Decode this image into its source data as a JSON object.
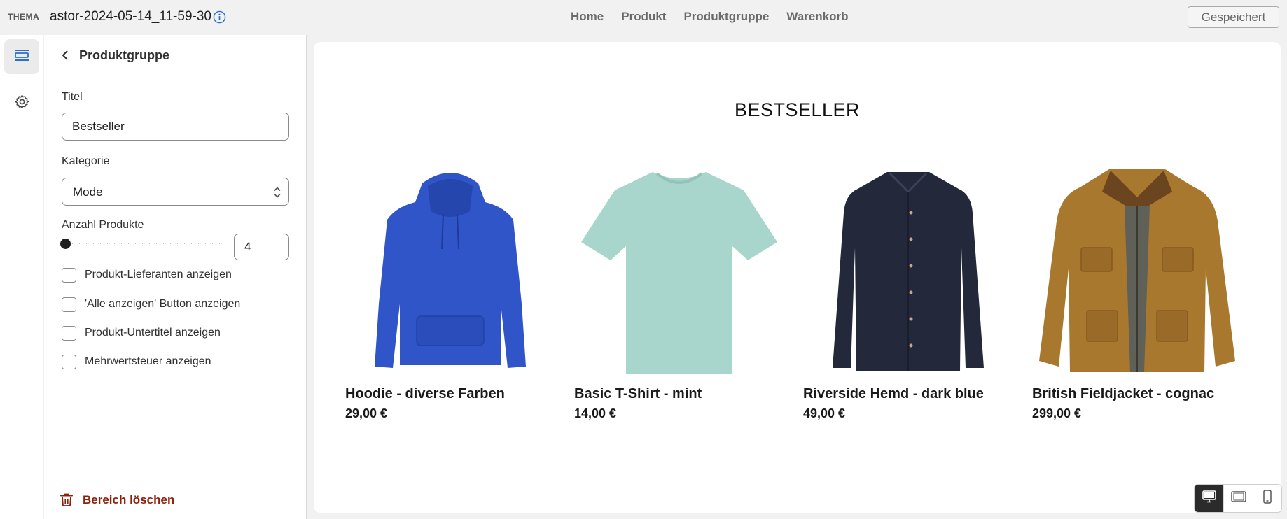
{
  "topbar": {
    "theme_label": "THEMA",
    "filename": "astor-2024-05-14_11-59-30",
    "nav": [
      "Home",
      "Produkt",
      "Produktgruppe",
      "Warenkorb"
    ],
    "save_label": "Gespeichert"
  },
  "rail": {
    "items": [
      {
        "icon": "sections-icon",
        "active": true
      },
      {
        "icon": "gear-icon",
        "active": false
      }
    ]
  },
  "panel": {
    "title": "Produktgruppe",
    "title_field": {
      "label": "Titel",
      "value": "Bestseller"
    },
    "category_field": {
      "label": "Kategorie",
      "value": "Mode"
    },
    "count_field": {
      "label": "Anzahl Produkte",
      "value": "4",
      "slider_fraction": 0
    },
    "checkboxes": [
      {
        "label": "Produkt-Lieferanten anzeigen",
        "checked": false
      },
      {
        "label": "'Alle anzeigen' Button anzeigen",
        "checked": false
      },
      {
        "label": "Produkt-Untertitel anzeigen",
        "checked": false
      },
      {
        "label": "Mehrwertsteuer anzeigen",
        "checked": false
      }
    ],
    "delete_label": "Bereich löschen"
  },
  "preview": {
    "section_title": "BESTSELLER",
    "products": [
      {
        "name": "Hoodie - diverse Farben",
        "price": "29,00 €",
        "image": "blue-hoodie",
        "color": "#2f55c8"
      },
      {
        "name": "Basic T-Shirt - mint",
        "price": "14,00 €",
        "image": "mint-tshirt",
        "color": "#a9d6cc"
      },
      {
        "name": "Riverside Hemd - dark blue",
        "price": "49,00 €",
        "image": "dark-blue-shirt",
        "color": "#23283a"
      },
      {
        "name": "British Fieldjacket - cognac",
        "price": "299,00 €",
        "image": "cognac-jacket",
        "color": "#a9782f"
      }
    ]
  },
  "device_toggle": {
    "options": [
      "desktop-icon",
      "tablet-icon",
      "mobile-icon"
    ],
    "active": "desktop-icon"
  },
  "colors": {
    "accent": "#2c6ecb",
    "danger": "#8e1f0b",
    "active_toggle": "#2b2b2b"
  }
}
